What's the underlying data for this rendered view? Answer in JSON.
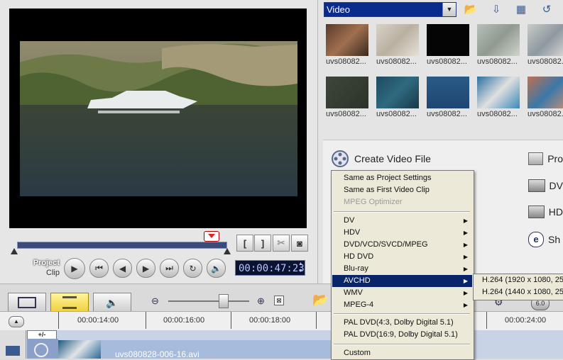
{
  "preview": {
    "mode_labels": [
      "Project",
      "Clip"
    ],
    "timecode": "00:00:47:23",
    "trim_start_label": "[",
    "trim_end_label": "]"
  },
  "library": {
    "dropdown_value": "Video",
    "thumbnails_row1": [
      "uvs08082...",
      "uvs08082...",
      "uvs08082...",
      "uvs08082...",
      "uvs08082..."
    ],
    "thumbnails_row2": [
      "uvs08082...",
      "uvs08082...",
      "uvs08082...",
      "uvs08082...",
      "uvs08082..."
    ]
  },
  "tasks": {
    "create_video_file": "Create Video File",
    "right_items": [
      "Pro",
      "DV",
      "HD",
      "Sh"
    ]
  },
  "menu": {
    "items": [
      {
        "label": "Same as Project Settings",
        "submenu": false
      },
      {
        "label": "Same as First Video Clip",
        "submenu": false
      },
      {
        "label": "MPEG Optimizer",
        "submenu": false,
        "disabled": true
      },
      {
        "label": "DV",
        "submenu": true
      },
      {
        "label": "HDV",
        "submenu": true
      },
      {
        "label": "DVD/VCD/SVCD/MPEG",
        "submenu": true
      },
      {
        "label": "HD DVD",
        "submenu": true
      },
      {
        "label": "Blu-ray",
        "submenu": true
      },
      {
        "label": "AVCHD",
        "submenu": true,
        "active": true
      },
      {
        "label": "WMV",
        "submenu": true
      },
      {
        "label": "MPEG-4",
        "submenu": true
      },
      {
        "label": "PAL  DVD(4:3, Dolby Digital 5.1)",
        "submenu": false
      },
      {
        "label": "PAL  DVD(16:9, Dolby Digital 5.1)",
        "submenu": false
      },
      {
        "label": "Custom",
        "submenu": false
      }
    ],
    "submenu_items": [
      "H.264 (1920 x 1080, 25",
      "H.264 (1440 x 1080, 25"
    ]
  },
  "timeline": {
    "ruler_ticks": [
      "00:00:14:00",
      "00:00:16:00",
      "00:00:18:00",
      "00:00:24:00"
    ],
    "zoom_fit_label": "+/-",
    "clip_name": "uvs080828-006-16.avi"
  },
  "colors": {
    "menu_highlight": "#0a246a",
    "library_dropdown": "#0b2b8c",
    "timecode_bg": "#0c1330"
  }
}
